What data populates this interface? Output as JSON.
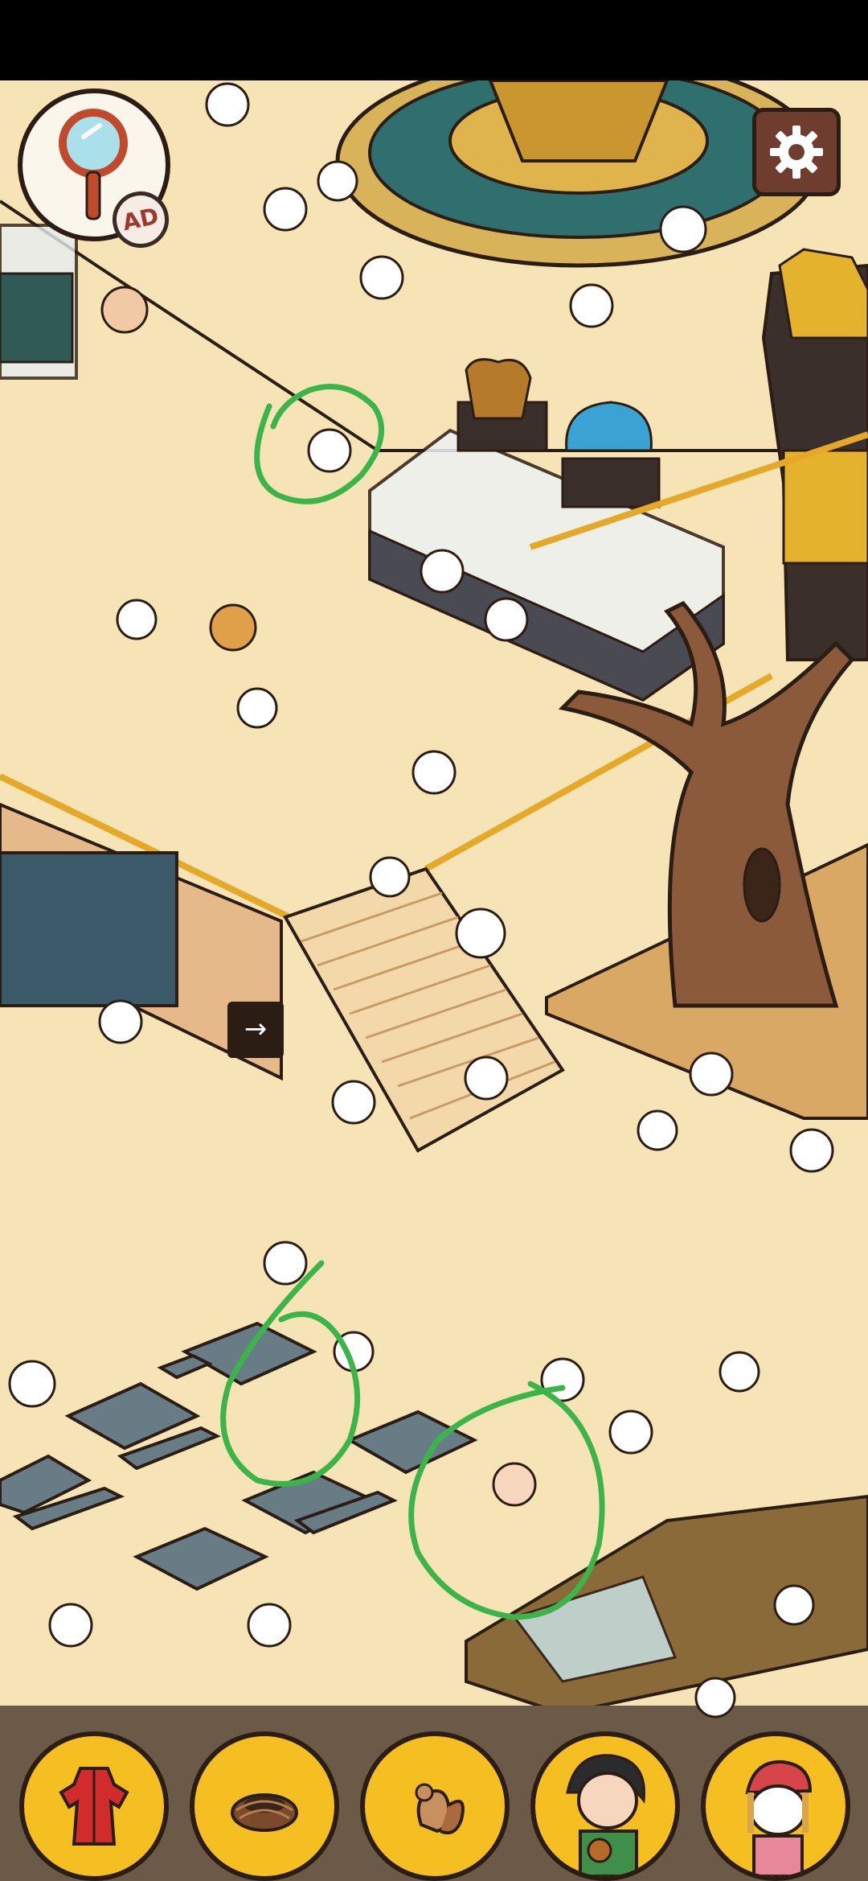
{
  "hint_button": {
    "icon": "magnifier-icon",
    "badge_label": "AD"
  },
  "settings_button": {
    "icon": "gear-icon"
  },
  "targets": [
    {
      "icon": "red-dress-icon"
    },
    {
      "icon": "bird-nest-icon"
    },
    {
      "icon": "squirrel-icon"
    },
    {
      "icon": "hiker-character-icon"
    },
    {
      "icon": "red-cap-girl-icon"
    }
  ],
  "colors": {
    "floor": "#f7e4b6",
    "target_slot": "#f5bf21",
    "marker": "#3bb44a",
    "settings_bg": "#6e3d2d"
  }
}
